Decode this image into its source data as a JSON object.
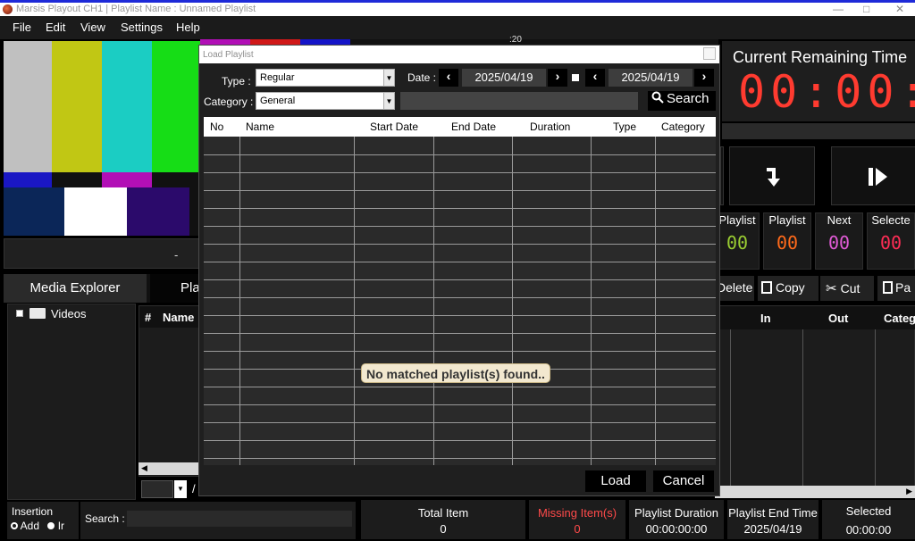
{
  "window": {
    "title": "Marsis Playout CH1 | Playlist Name : Unnamed Playlist",
    "minimize": "—",
    "maximize": "□",
    "close": "✕"
  },
  "menu": [
    "File",
    "Edit",
    "View",
    "Settings",
    "Help"
  ],
  "preview": {
    "status": "-",
    "overlay_text": ":20"
  },
  "left_tabs": {
    "media_explorer": "Media Explorer",
    "playlist_partial": "Pla"
  },
  "explorer": {
    "tree_root": "Videos",
    "list_col_no": "#",
    "list_col_name": "Name",
    "page_sep": "/"
  },
  "insertion": {
    "label": "Insertion",
    "opt_add": "Add",
    "opt_insert": "Ir"
  },
  "search": {
    "label": "Search :"
  },
  "remaining": {
    "label": "Current Remaining Time",
    "time": "00:00:"
  },
  "counters": [
    {
      "label": "Playlist",
      "value": "00",
      "color": "#9acd32"
    },
    {
      "label": "Playlist",
      "value": "00",
      "color": "#ff6a1a"
    },
    {
      "label": "Next",
      "value": "00",
      "color": "#e05bd6"
    },
    {
      "label": "Selecte",
      "value": "00",
      "color": "#ff2d55"
    }
  ],
  "ops": {
    "delete": "Delete",
    "copy": "Copy",
    "cut": "Cut",
    "paste": "Pa"
  },
  "right_table": {
    "col_in": "In",
    "col_out": "Out",
    "col_category": "Categ"
  },
  "status": {
    "total_item_label": "Total Item",
    "total_item_value": "0",
    "missing_label": "Missing Item(s)",
    "missing_value": "0",
    "missing_color": "#ff4a4a",
    "duration_label": "Playlist Duration",
    "duration_value": "00:00:00:00",
    "end_time_label": "Playlist End Time",
    "end_time_value": "2025/04/19",
    "selected_label": "Selected",
    "selected_value": "00:00:00"
  },
  "dialog": {
    "title": "Load Playlist",
    "type_label": "Type :",
    "type_value": "Regular",
    "category_label": "Category :",
    "category_value": "General",
    "date_label": "Date :",
    "date_from": "2025/04/19",
    "date_to": "2025/04/19",
    "search_button": "Search",
    "columns": [
      "No",
      "Name",
      "Start Date",
      "End Date",
      "Duration",
      "Type",
      "Category"
    ],
    "empty_message": "No matched playlist(s) found..",
    "load_button": "Load",
    "cancel_button": "Cancel"
  }
}
